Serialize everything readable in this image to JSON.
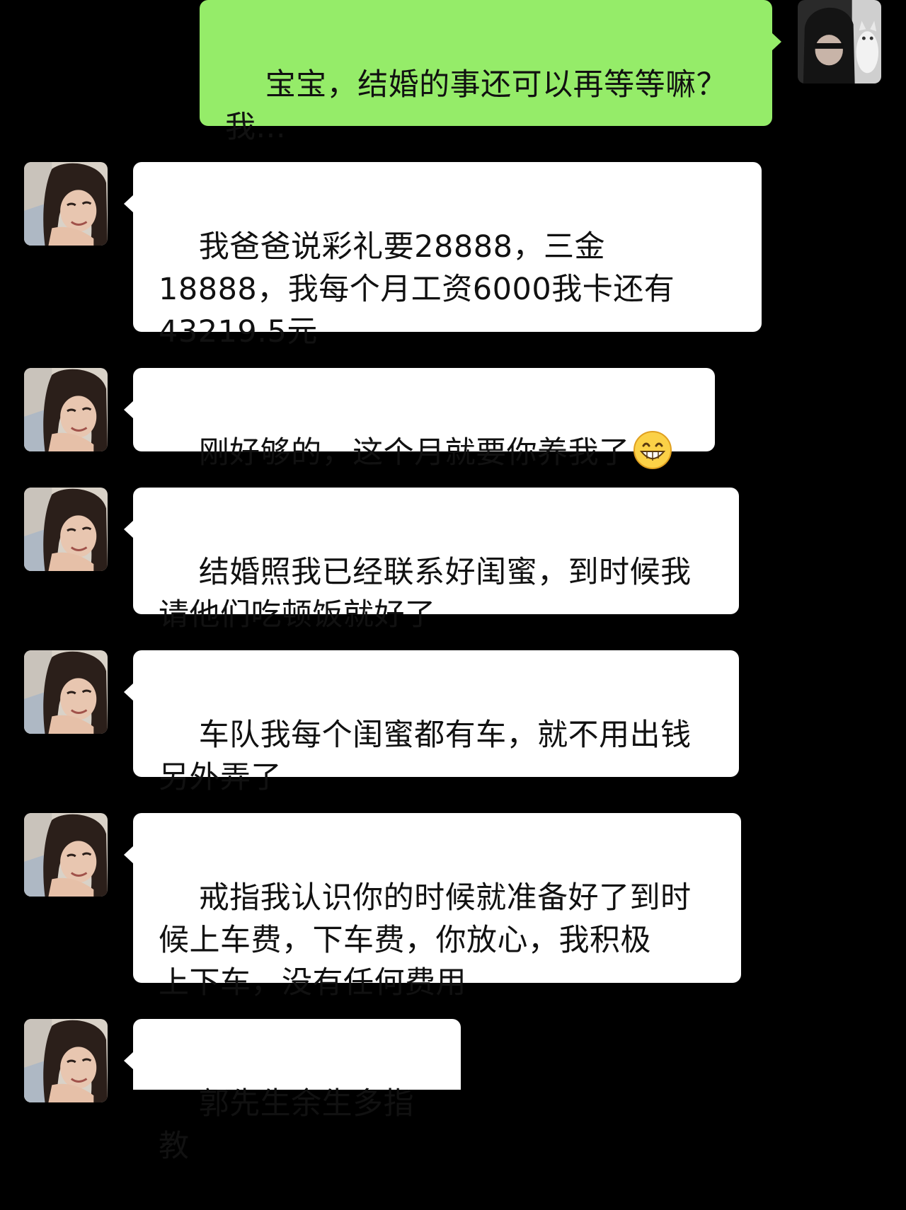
{
  "chat": {
    "messages": [
      {
        "sender": "me",
        "avatar_icon": "hooded-person-with-cat-avatar-icon",
        "text": "宝宝，结婚的事还可以再等等嘛？\n我..."
      },
      {
        "sender": "girlfriend",
        "avatar_icon": "smiling-woman-avatar-icon",
        "text": "我爸爸说彩礼要28888，三金\n18888，我每个月工资6000我卡还有\n43219.5元"
      },
      {
        "sender": "girlfriend",
        "avatar_icon": "smiling-woman-avatar-icon",
        "text": "刚好够的，这个月就要你养我了",
        "emoji": "grinning-face-icon"
      },
      {
        "sender": "girlfriend",
        "avatar_icon": "smiling-woman-avatar-icon",
        "text": "结婚照我已经联系好闺蜜，到时候我\n请他们吃顿饭就好了"
      },
      {
        "sender": "girlfriend",
        "avatar_icon": "smiling-woman-avatar-icon",
        "text": "车队我每个闺蜜都有车，就不用出钱\n另外弄了"
      },
      {
        "sender": "girlfriend",
        "avatar_icon": "smiling-woman-avatar-icon",
        "text": "戒指我认识你的时候就准备好了到时\n候上车费，下车费，你放心，我积极\n上下车，没有任何费用"
      },
      {
        "sender": "girlfriend",
        "avatar_icon": "smiling-woman-avatar-icon",
        "text": "郭先生余生多指教"
      }
    ]
  },
  "colors": {
    "background": "#000000",
    "incoming_bubble": "#ffffff",
    "outgoing_bubble": "#95ec69",
    "text": "#111111"
  }
}
